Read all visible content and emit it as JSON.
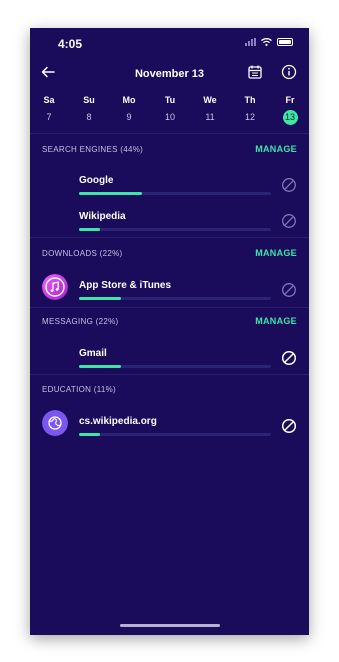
{
  "status": {
    "time": "4:05"
  },
  "header": {
    "title": "November 13"
  },
  "days": [
    {
      "name": "Sa",
      "num": "7"
    },
    {
      "name": "Su",
      "num": "8"
    },
    {
      "name": "Mo",
      "num": "9"
    },
    {
      "name": "Tu",
      "num": "10"
    },
    {
      "name": "We",
      "num": "11"
    },
    {
      "name": "Th",
      "num": "12"
    },
    {
      "name": "Fr",
      "num": "13"
    }
  ],
  "selected_day": "13",
  "sections": [
    {
      "title": "SEARCH ENGINES (44%)",
      "manage_label": "MANAGE",
      "items": [
        {
          "name": "Google",
          "usage_fraction": 0.33,
          "blocked": false
        },
        {
          "name": "Wikipedia",
          "usage_fraction": 0.11,
          "blocked": false
        }
      ]
    },
    {
      "title": "DOWNLOADS (22%)",
      "manage_label": "MANAGE",
      "items": [
        {
          "name": "App Store & iTunes",
          "usage_fraction": 0.22,
          "blocked": false,
          "icon": "itunes-icon"
        }
      ]
    },
    {
      "title": "MESSAGING (22%)",
      "manage_label": "MANAGE",
      "items": [
        {
          "name": "Gmail",
          "usage_fraction": 0.22,
          "blocked": true
        }
      ]
    },
    {
      "title": "EDUCATION (11%)",
      "manage_label": "",
      "items": [
        {
          "name": "cs.wikipedia.org",
          "usage_fraction": 0.11,
          "blocked": true,
          "icon": "globe-icon"
        }
      ]
    }
  ],
  "colors": {
    "background": "#1b0c5b",
    "accent": "#3ee6a5",
    "track": "#2b2375"
  }
}
